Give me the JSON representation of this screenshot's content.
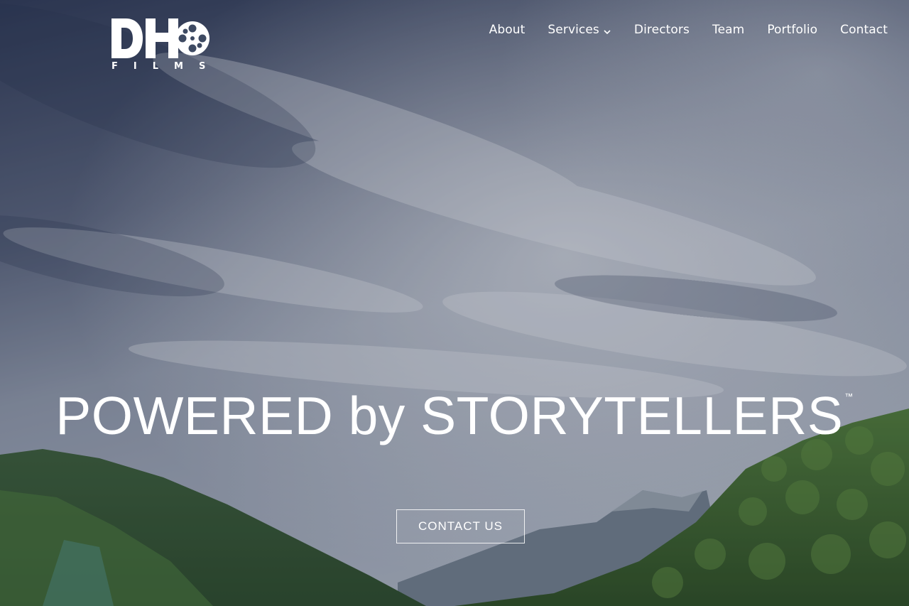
{
  "brand": {
    "logo_main": "DH",
    "logo_sub": "FILMS"
  },
  "nav": {
    "items": [
      {
        "label": "About"
      },
      {
        "label": "Services",
        "has_dropdown": true
      },
      {
        "label": "Directors"
      },
      {
        "label": "Team"
      },
      {
        "label": "Portfolio"
      },
      {
        "label": "Contact"
      }
    ],
    "dropdown_icon": "chevron-down-icon"
  },
  "hero": {
    "headline": "POWERED by STORYTELLERS",
    "trademark": "™",
    "cta_label": "CONTACT US",
    "background": "cloudy-sky-mountains-photo"
  },
  "colors": {
    "text": "#ffffff",
    "sky_dark": "#3a4663",
    "sky_light": "#c4cad4",
    "forest": "#3f6a34"
  }
}
